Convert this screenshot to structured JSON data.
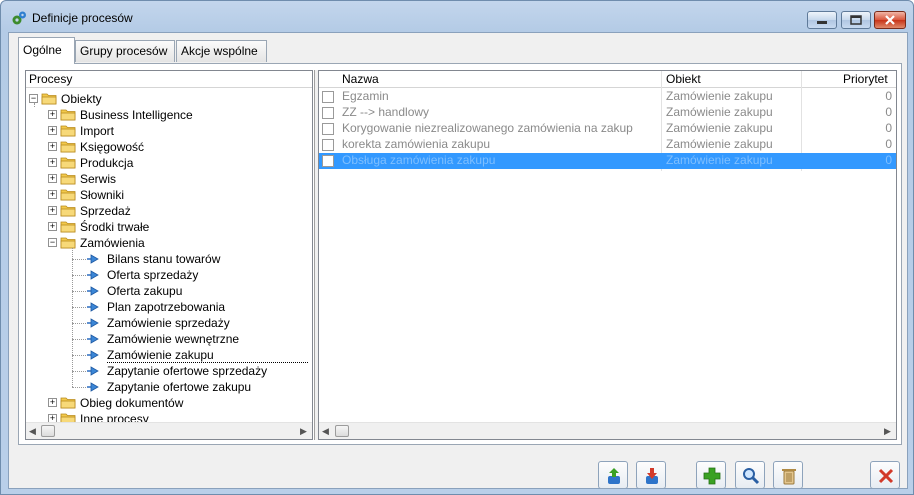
{
  "window": {
    "title": "Definicje procesów",
    "minimize_glyph": "▬",
    "maximize_glyph": "□",
    "close_glyph": "✕"
  },
  "tabs": [
    {
      "label": "Ogólne",
      "active": true
    },
    {
      "label": "Grupy procesów",
      "active": false
    },
    {
      "label": "Akcje wspólne",
      "active": false
    }
  ],
  "tree": {
    "header": "Procesy",
    "root": "Obiekty",
    "folders": [
      "Business Intelligence",
      "Import",
      "Księgowość",
      "Produkcja",
      "Serwis",
      "Słowniki",
      "Sprzedaż",
      "Środki trwałe",
      "Zamówienia"
    ],
    "zamowienia_children": [
      "Bilans stanu towarów",
      "Oferta sprzedaży",
      "Oferta zakupu",
      "Plan zapotrzebowania",
      "Zamówienie sprzedaży",
      "Zamówienie wewnętrzne",
      "Zamówienie zakupu",
      "Zapytanie ofertowe sprzedaży",
      "Zapytanie ofertowe zakupu"
    ],
    "selected": "Zamówienie zakupu",
    "after": [
      "Obieg dokumentów",
      "Inne procesy"
    ]
  },
  "grid": {
    "columns": [
      "Nazwa",
      "Obiekt",
      "Priorytet"
    ],
    "rows": [
      {
        "name": "Egzamin",
        "object": "Zamówienie zakupu",
        "priority": "0",
        "selected": false
      },
      {
        "name": "ZZ --> handlowy",
        "object": "Zamówienie zakupu",
        "priority": "0",
        "selected": false
      },
      {
        "name": "Korygowanie niezrealizowanego zamówienia na zakup",
        "object": "Zamówienie zakupu",
        "priority": "0",
        "selected": false
      },
      {
        "name": "korekta zamówienia zakupu",
        "object": "Zamówienie zakupu",
        "priority": "0",
        "selected": false
      },
      {
        "name": "Obsługa zamówienia zakupu",
        "object": "Zamówienie zakupu",
        "priority": "0",
        "selected": true
      }
    ]
  },
  "toolbar": [
    "export-icon",
    "import-icon",
    "add-icon",
    "preview-icon",
    "delete-icon",
    "cancel-icon"
  ],
  "colors": {
    "selection": "#3399ff",
    "accent_green": "#3aa123",
    "close_red": "#d23a2a"
  }
}
